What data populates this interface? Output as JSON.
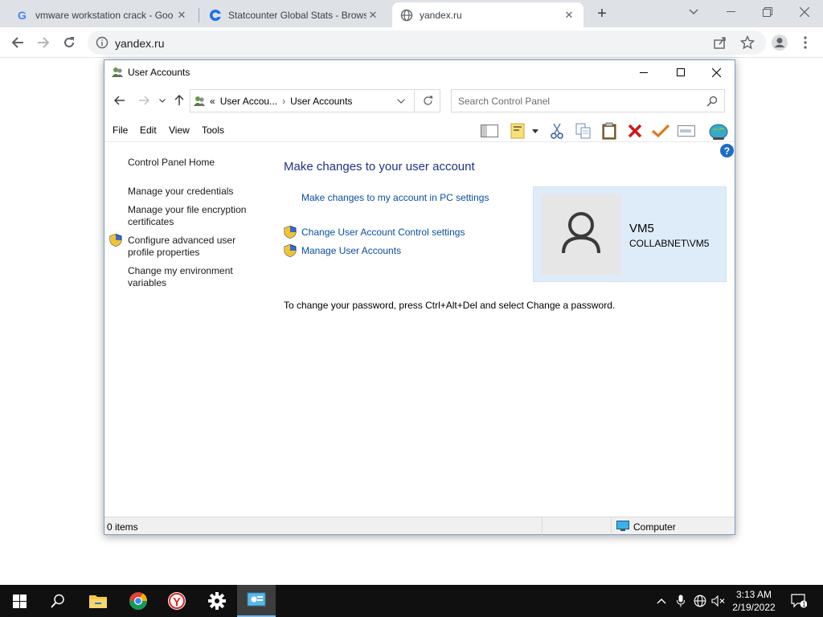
{
  "browser": {
    "tabs": [
      {
        "title": "vmware workstation crack - Goo",
        "favicon": "google-g-icon"
      },
      {
        "title": "Statcounter Global Stats - Brows",
        "favicon": "statcounter-icon"
      },
      {
        "title": "yandex.ru",
        "favicon": "globe-icon"
      }
    ],
    "url": "yandex.ru"
  },
  "window": {
    "title": "User Accounts",
    "address": {
      "overflow": "«",
      "crumb1": "User Accou...",
      "crumb2": "User Accounts"
    },
    "search_placeholder": "Search Control Panel",
    "menu": {
      "file": "File",
      "edit": "Edit",
      "view": "View",
      "tools": "Tools"
    },
    "left_links": {
      "home": "Control Panel Home",
      "credentials": "Manage your credentials",
      "encryption": "Manage your file encryption certificates",
      "advanced": "Configure advanced user profile properties",
      "env": "Change my environment variables"
    },
    "main": {
      "title": "Make changes to your user account",
      "pc_settings": "Make changes to my account in PC settings",
      "uac": "Change User Account Control settings",
      "manage": "Manage User Accounts",
      "note": "To change your password, press Ctrl+Alt+Del and select Change a password."
    },
    "user": {
      "name": "VM5",
      "domain": "COLLABNET\\VM5"
    },
    "status": {
      "items": "0 items",
      "location": "Computer"
    }
  },
  "taskbar": {
    "time": "3:13 AM",
    "date": "2/19/2022",
    "notifications": "1"
  },
  "colors": {
    "link": "#0a4ea0",
    "title_blue": "#1e3287",
    "card_bg": "#deecf9",
    "taskbar": "#101010"
  }
}
